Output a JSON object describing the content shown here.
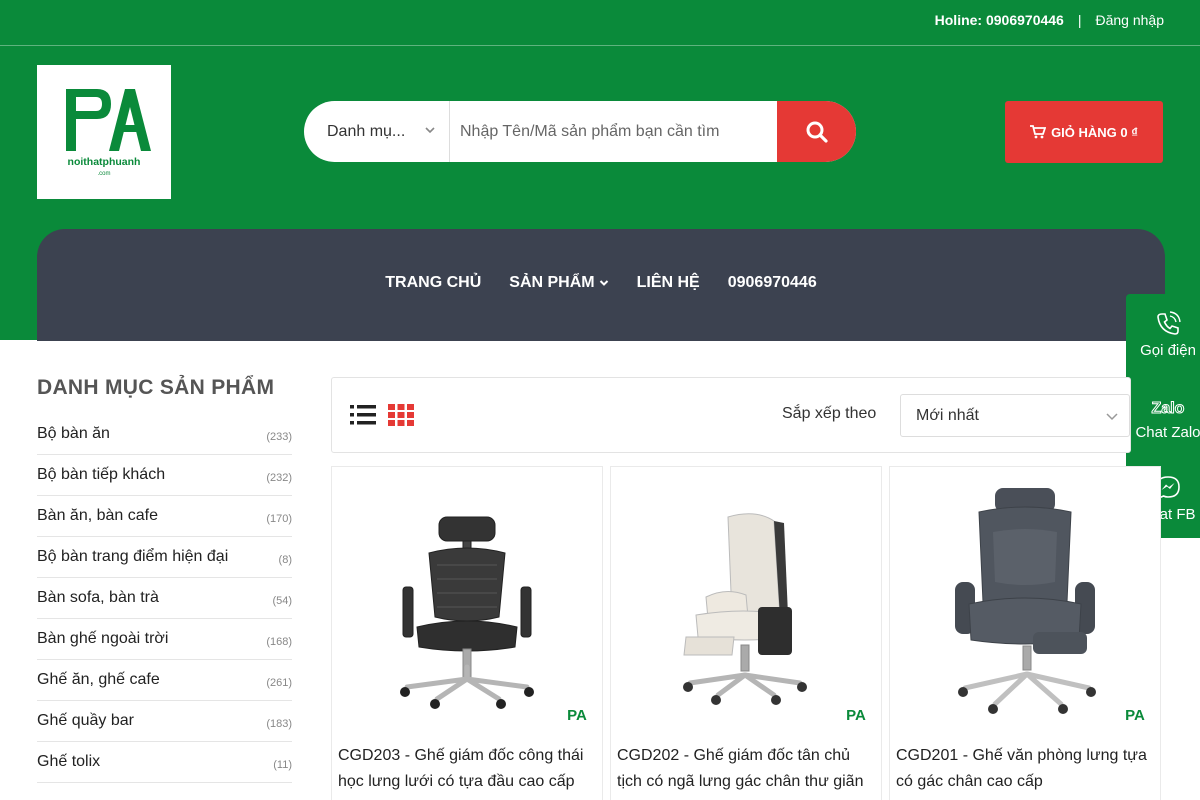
{
  "topbar": {
    "hotline": "Holine: 0906970446",
    "separator": "|",
    "login": "Đăng nhập"
  },
  "logo": {
    "mark": "PA",
    "brand": "noithatphuanh",
    "domain": ".com"
  },
  "search": {
    "category_label": "Danh mụ...",
    "placeholder": "Nhập Tên/Mã sản phẩm bạn cần tìm"
  },
  "cart": {
    "label": "GIỎ HÀNG 0 ₫"
  },
  "nav": {
    "items": [
      {
        "label": "TRANG CHỦ"
      },
      {
        "label": "SẢN PHẨM"
      },
      {
        "label": "LIÊN HỆ"
      },
      {
        "label": "0906970446"
      }
    ]
  },
  "float_panel": {
    "items": [
      {
        "label": "Gọi điện",
        "icon": "phone-icon"
      },
      {
        "label": "Chat Zalo",
        "icon": "zalo-icon",
        "logo_text": "Zalo"
      },
      {
        "label": "Chat FB",
        "icon": "messenger-icon"
      }
    ]
  },
  "sidebar": {
    "title": "DANH MỤC SẢN PHẨM",
    "categories": [
      {
        "name": "Bộ bàn ăn",
        "count": "(233)"
      },
      {
        "name": "Bộ bàn tiếp khách",
        "count": "(232)"
      },
      {
        "name": "Bàn ăn, bàn cafe",
        "count": "(170)"
      },
      {
        "name": "Bộ bàn trang điểm hiện đại",
        "count": "(8)"
      },
      {
        "name": "Bàn sofa, bàn trà",
        "count": "(54)"
      },
      {
        "name": "Bàn ghế ngoài trời",
        "count": "(168)"
      },
      {
        "name": "Ghế ăn, ghế cafe",
        "count": "(261)"
      },
      {
        "name": "Ghế quầy bar",
        "count": "(183)"
      },
      {
        "name": "Ghế tolix",
        "count": "(11)"
      }
    ]
  },
  "toolbar": {
    "sort_label": "Sắp xếp theo",
    "sort_value": "Mới nhất"
  },
  "products": [
    {
      "name": "CGD203 - Ghế giám đốc công thái học lưng lưới có tựa đầu cao cấp"
    },
    {
      "name": "CGD202 - Ghế giám đốc tân chủ tịch có ngã lưng gác chân thư giãn"
    },
    {
      "name": "CGD201 - Ghế văn phòng lưng tựa có gác chân cao cấp"
    }
  ],
  "colors": {
    "brand_green": "#0a8a3a",
    "accent_red": "#e53935",
    "nav_dark": "#3c4250"
  }
}
